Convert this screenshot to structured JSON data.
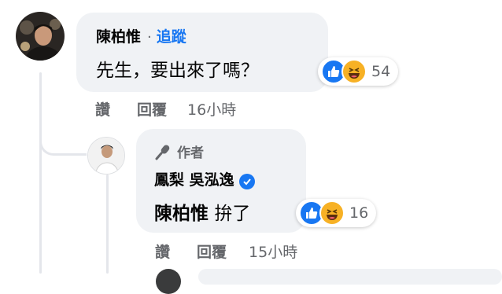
{
  "comment": {
    "author": "陳柏惟",
    "separator": "·",
    "follow_label": "追蹤",
    "text": "先生，要出來了嗎？",
    "reaction_count": "54",
    "actions": {
      "like": "讚",
      "reply": "回覆",
      "time": "16小時"
    }
  },
  "reply": {
    "author_badge": "作者",
    "author": "鳳梨 吳泓逸",
    "mention": "陳柏惟",
    "text": "拚了",
    "reaction_count": "16",
    "actions": {
      "like": "讚",
      "reply": "回覆",
      "time": "15小時"
    }
  },
  "colors": {
    "bubble_bg": "#f0f2f5",
    "link_blue": "#1877f2",
    "meta_grey": "#65676b",
    "haha_yellow": "#f7b125"
  },
  "icons": [
    "like-icon",
    "haha-icon",
    "microphone-icon",
    "verified-badge-icon"
  ]
}
